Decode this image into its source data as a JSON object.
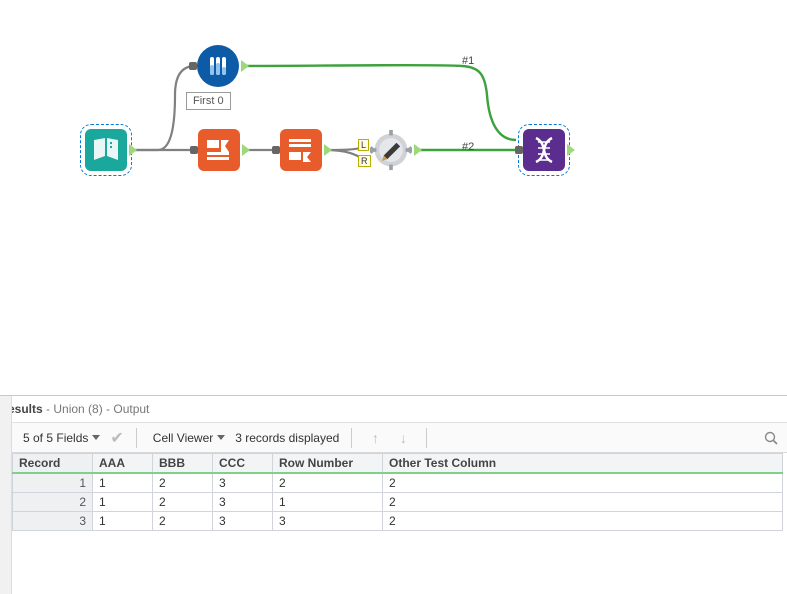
{
  "canvas": {
    "nodes": {
      "input": "Text Input",
      "sample": "Sample",
      "formula": "Formula",
      "multirow": "Multi-Row Formula",
      "join": "Join",
      "union": "Union"
    },
    "comments": {
      "first0": "First 0"
    },
    "connection_labels": {
      "c1": "#1",
      "c2": "#2"
    },
    "anchors": {
      "L": "L",
      "R": "R"
    }
  },
  "results": {
    "title": "esults",
    "subtitle": " - Union (8) - Output"
  },
  "toolbar": {
    "fields_summary": "5 of 5 Fields",
    "cell_viewer": "Cell Viewer",
    "records_display": "3 records displayed"
  },
  "grid": {
    "headers": [
      "Record",
      "AAA",
      "BBB",
      "CCC",
      "Row Number",
      "Other Test Column"
    ],
    "rows": [
      {
        "rec": "1",
        "AAA": "1",
        "BBB": "2",
        "CCC": "3",
        "RowNumber": "2",
        "Other": "2"
      },
      {
        "rec": "2",
        "AAA": "1",
        "BBB": "2",
        "CCC": "3",
        "RowNumber": "1",
        "Other": "2"
      },
      {
        "rec": "3",
        "AAA": "1",
        "BBB": "2",
        "CCC": "3",
        "RowNumber": "3",
        "Other": "2"
      }
    ]
  },
  "colors": {
    "accent_green": "#3da13d",
    "gray_wire": "#808080"
  }
}
